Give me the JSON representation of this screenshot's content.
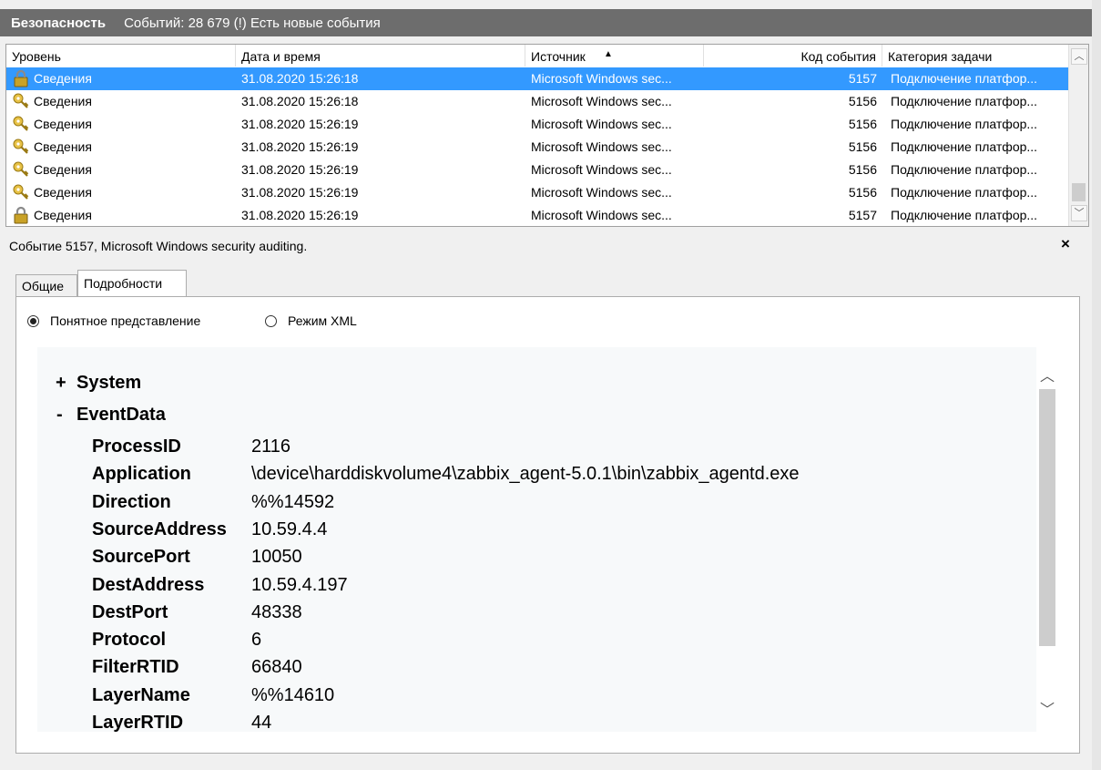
{
  "titlebar": {
    "log_name": "Безопасность",
    "status": "Событий: 28 679 (!) Есть новые события"
  },
  "columns": {
    "level": "Уровень",
    "datetime": "Дата и время",
    "source": "Источник",
    "event_id": "Код события",
    "category": "Категория задачи"
  },
  "events": [
    {
      "icon": "lock-icon",
      "level": "Сведения",
      "datetime": "31.08.2020 15:26:18",
      "source": "Microsoft Windows sec...",
      "event_id": "5157",
      "category": "Подключение платфор..."
    },
    {
      "icon": "key-icon",
      "level": "Сведения",
      "datetime": "31.08.2020 15:26:18",
      "source": "Microsoft Windows sec...",
      "event_id": "5156",
      "category": "Подключение платфор..."
    },
    {
      "icon": "key-icon",
      "level": "Сведения",
      "datetime": "31.08.2020 15:26:19",
      "source": "Microsoft Windows sec...",
      "event_id": "5156",
      "category": "Подключение платфор..."
    },
    {
      "icon": "key-icon",
      "level": "Сведения",
      "datetime": "31.08.2020 15:26:19",
      "source": "Microsoft Windows sec...",
      "event_id": "5156",
      "category": "Подключение платфор..."
    },
    {
      "icon": "key-icon",
      "level": "Сведения",
      "datetime": "31.08.2020 15:26:19",
      "source": "Microsoft Windows sec...",
      "event_id": "5156",
      "category": "Подключение платфор..."
    },
    {
      "icon": "key-icon",
      "level": "Сведения",
      "datetime": "31.08.2020 15:26:19",
      "source": "Microsoft Windows sec...",
      "event_id": "5156",
      "category": "Подключение платфор..."
    },
    {
      "icon": "lock-icon",
      "level": "Сведения",
      "datetime": "31.08.2020 15:26:19",
      "source": "Microsoft Windows sec...",
      "event_id": "5157",
      "category": "Подключение платфор..."
    }
  ],
  "selected_row": 0,
  "detail": {
    "title": "Событие 5157, Microsoft Windows security auditing.",
    "close": "×",
    "tabs": [
      "Общие",
      "Подробности"
    ],
    "active_tab": 1,
    "view_friendly": "Понятное представление",
    "view_xml": "Режим XML",
    "system_sign": "+",
    "system_label": "System",
    "eventdata_sign": "-",
    "eventdata_label": "EventData",
    "fields": [
      {
        "k": "ProcessID",
        "v": "2116"
      },
      {
        "k": "Application",
        "v": "\\device\\harddiskvolume4\\zabbix_agent-5.0.1\\bin\\zabbix_agentd.exe"
      },
      {
        "k": "Direction",
        "v": "%%14592"
      },
      {
        "k": "SourceAddress",
        "v": "10.59.4.4"
      },
      {
        "k": "SourcePort",
        "v": "10050"
      },
      {
        "k": "DestAddress",
        "v": "10.59.4.197"
      },
      {
        "k": "DestPort",
        "v": "48338"
      },
      {
        "k": "Protocol",
        "v": "6"
      },
      {
        "k": "FilterRTID",
        "v": "66840"
      },
      {
        "k": "LayerName",
        "v": "%%14610"
      },
      {
        "k": "LayerRTID",
        "v": "44"
      }
    ]
  },
  "colors": {
    "selection": "#3399ff",
    "titlebar": "#6d6d6d"
  }
}
